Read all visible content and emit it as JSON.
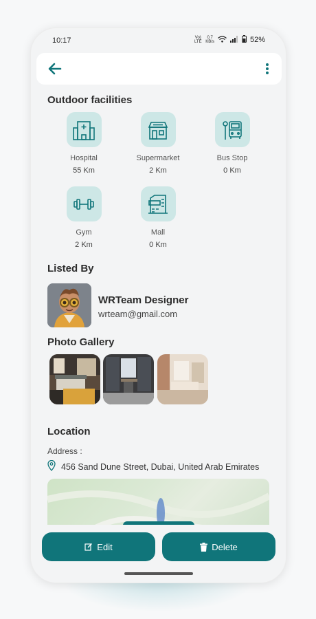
{
  "status_bar": {
    "time": "10:17",
    "volte": "Vo) LTE",
    "speed_value": "0.7",
    "speed_unit": "KB/s",
    "battery": "52%"
  },
  "app_bar": {
    "back_icon": "arrow-left-icon",
    "menu_icon": "more-vertical-icon"
  },
  "facilities": {
    "title": "Outdoor facilities",
    "items": [
      {
        "name": "Hospital",
        "distance": "55 Km",
        "icon": "hospital-icon"
      },
      {
        "name": "Supermarket",
        "distance": "2 Km",
        "icon": "supermarket-icon"
      },
      {
        "name": "Bus Stop",
        "distance": "0 Km",
        "icon": "bus-stop-icon"
      },
      {
        "name": "Gym",
        "distance": "2 Km",
        "icon": "dumbbell-icon"
      },
      {
        "name": "Mall",
        "distance": "0 Km",
        "icon": "mall-icon"
      }
    ]
  },
  "listed_by": {
    "title": "Listed By",
    "name": "WRTeam Designer",
    "email": "wrteam@gmail.com"
  },
  "gallery": {
    "title": "Photo Gallery"
  },
  "location": {
    "title": "Location",
    "address_label": "Address :",
    "address": "456 Sand Dune Street, Dubai, United Arab Emirates"
  },
  "actions": {
    "edit_label": "Edit",
    "delete_label": "Delete"
  },
  "colors": {
    "accent": "#10757a",
    "icon_bg": "#cde7e6"
  }
}
